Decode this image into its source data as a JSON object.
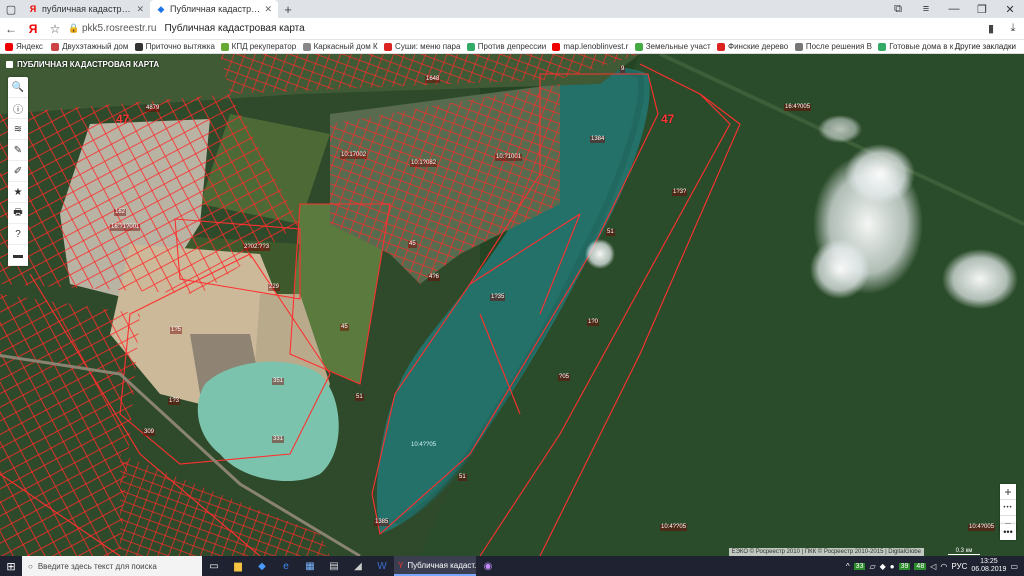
{
  "browser": {
    "tabs": [
      {
        "label": "публичная кадастровая к",
        "favicon": "Я",
        "favicon_color": "#e00"
      },
      {
        "label": "Публичная кадастровая к",
        "favicon": "◆",
        "favicon_color": "#1a73e8"
      }
    ],
    "new_tab": "+",
    "address": {
      "host": "pkk5.rosreestr.ru",
      "title": "Публичная кадастровая карта"
    },
    "bookmarks": [
      {
        "label": "Яндекс",
        "color": "#e00"
      },
      {
        "label": "Двухэтажный дом",
        "color": "#c44"
      },
      {
        "label": "Приточно вытяжка",
        "color": "#333"
      },
      {
        "label": "КПД рекуператор",
        "color": "#6a3"
      },
      {
        "label": "Каркасный дом К",
        "color": "#888"
      },
      {
        "label": "Суши: меню пара",
        "color": "#d22"
      },
      {
        "label": "Против депрессии",
        "color": "#3a6"
      },
      {
        "label": "map.lenoblinvest.r",
        "color": "#e00"
      },
      {
        "label": "Земельные участ",
        "color": "#4a4"
      },
      {
        "label": "Финские дерево",
        "color": "#d22"
      },
      {
        "label": "После решения В",
        "color": "#777"
      },
      {
        "label": "Готовые дома в к",
        "color": "#3a6"
      }
    ],
    "bookmarks_more": "Другие закладки"
  },
  "map": {
    "title": "ПУБЛИЧНАЯ КАДАСТРОВАЯ КАРТА",
    "attribution": "ЕЭКО © Росреестр 2010 | ПКК © Росреестр 2010-2015 | DigitalGlobe",
    "scale": "0.3 км",
    "labels": {
      "n47a": "47",
      "n47b": "47",
      "l1": "4879",
      "l2": "1648",
      "l3": "162",
      "l4": "9",
      "l5": "10:17002",
      "l6": "10:1?082",
      "l7": "10:?1001",
      "l8": "1384",
      "l9": "16:4?005",
      "l10": "16:?1?001",
      "l11": "2?02:??3",
      "l12": "45",
      "l13": "229",
      "l14": "4?6",
      "l15": "45",
      "l16": "1?5",
      "l17": "351",
      "l18": "??6",
      "l19": "1?35",
      "l20": "51",
      "l21": "1?3?",
      "l22": "1?0",
      "l23": "331",
      "l24": "309",
      "l25": "10:4??05",
      "l26": "1?3",
      "l27": "51",
      "l28": "?05",
      "l29": "1385",
      "l30": "10:4??05",
      "l31": "1?:4?005",
      "l32": "10:4?005",
      "l33": "51"
    }
  },
  "tools": [
    {
      "name": "search-icon",
      "glyph": "🔍"
    },
    {
      "name": "info-icon",
      "glyph": "ⓘ"
    },
    {
      "name": "layers-icon",
      "glyph": "≋"
    },
    {
      "name": "ruler-icon",
      "glyph": "✎"
    },
    {
      "name": "draw-icon",
      "glyph": "✐"
    },
    {
      "name": "favorites-icon",
      "glyph": "★"
    },
    {
      "name": "print-icon",
      "glyph": "🖶"
    },
    {
      "name": "help-icon",
      "glyph": "?"
    },
    {
      "name": "keyboard-icon",
      "glyph": "▬"
    }
  ],
  "zoom": {
    "plus": "+",
    "mid": "•••",
    "minus": "−",
    "more": "•••"
  },
  "taskbar": {
    "search_placeholder": "Введите здесь текст для поиска",
    "active_app": "Публичная кадаст...",
    "tray_badges": [
      "33",
      "39",
      "48"
    ],
    "lang": "РУС",
    "time": "13:25",
    "date": "06.08.2019"
  }
}
